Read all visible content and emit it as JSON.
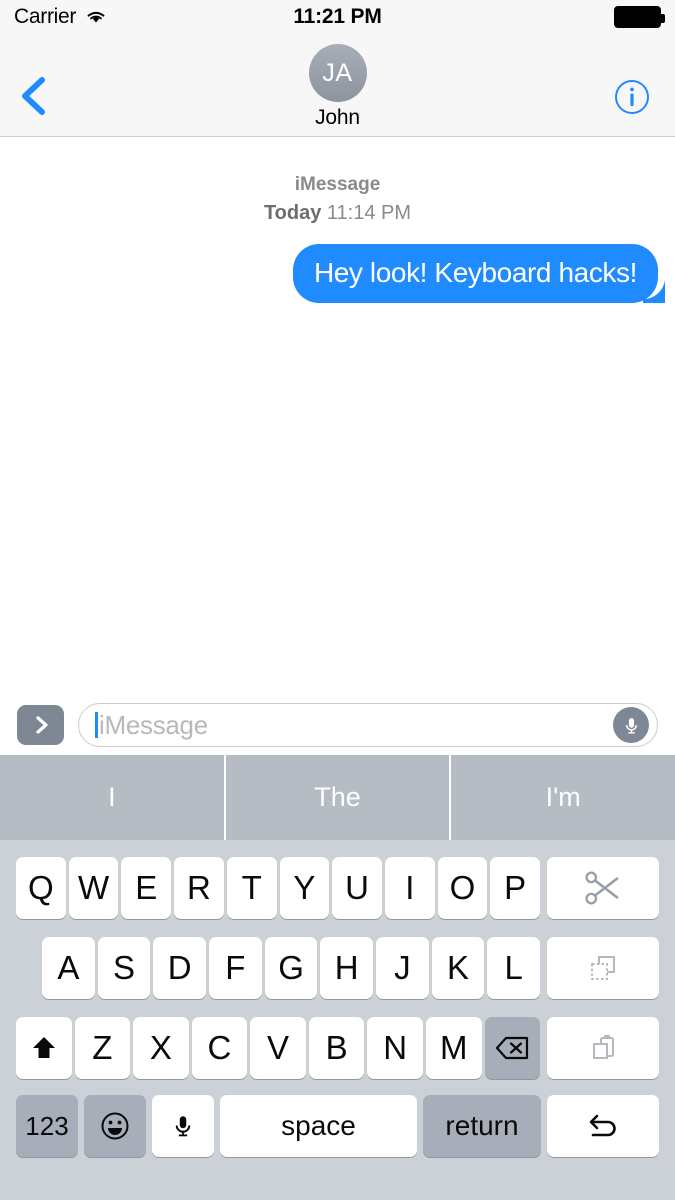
{
  "status_bar": {
    "carrier": "Carrier",
    "wifi_icon": "wifi-icon",
    "time": "11:21 PM",
    "battery_icon": "battery-full-icon"
  },
  "nav_header": {
    "back_icon": "chevron-left-icon",
    "info_icon": "info-circle-icon",
    "avatar_initials": "JA",
    "contact_name": "John",
    "accent_color": "#1f8bff",
    "avatar_color": "#989ea9"
  },
  "conversation": {
    "service_label": "iMessage",
    "day_label": "Today",
    "time_label": "11:14 PM",
    "messages": [
      {
        "text": "Hey look! Keyboard hacks!",
        "direction": "sent",
        "color": "#1f8bff"
      }
    ]
  },
  "input_bar": {
    "send_icon": "chevron-right-icon",
    "placeholder": "iMessage",
    "value": "",
    "mic_icon": "microphone-icon"
  },
  "predictive_bar": {
    "suggestions": [
      "I",
      "The",
      "I'm"
    ],
    "background_color": "#b5bcc4"
  },
  "keyboard": {
    "background_color": "#ccd0d7",
    "row1": [
      "Q",
      "W",
      "E",
      "R",
      "T",
      "Y",
      "U",
      "I",
      "O",
      "P"
    ],
    "row1_special": {
      "label": "",
      "icon": "scissors-cut-icon"
    },
    "row2": [
      "A",
      "S",
      "D",
      "F",
      "G",
      "H",
      "J",
      "K",
      "L"
    ],
    "row2_special": {
      "label": "",
      "icon": "copy-icon"
    },
    "row3_shift": {
      "label": "",
      "icon": "shift-arrow-icon"
    },
    "row3": [
      "Z",
      "X",
      "C",
      "V",
      "B",
      "N",
      "M"
    ],
    "row3_delete": {
      "label": "",
      "icon": "delete-backspace-icon"
    },
    "row3_special": {
      "label": "",
      "icon": "paste-clipboard-icon"
    },
    "row4": {
      "numbers": "123",
      "emoji_icon": "emoji-smiley-icon",
      "mic_icon": "microphone-icon",
      "space": "space",
      "return": "return",
      "undo_icon": "undo-arrow-icon"
    }
  }
}
